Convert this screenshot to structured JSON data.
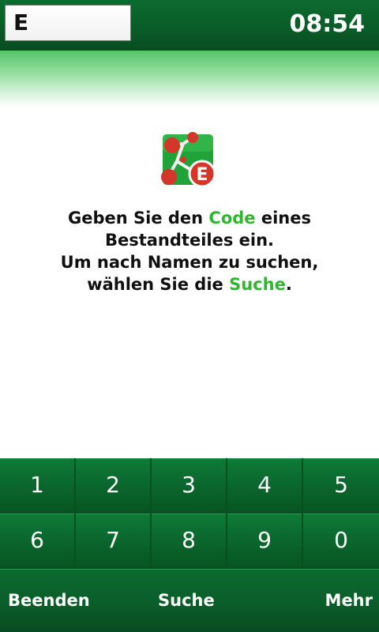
{
  "header": {
    "code_input_value": "E",
    "clock": "08:54"
  },
  "app_logo": {
    "badge_letter": "E",
    "colors": {
      "background": "#22a33a",
      "nodes": "#d4372a",
      "badge": "#d4372a"
    }
  },
  "message": {
    "line1_prefix": "Geben Sie den ",
    "line1_highlight": "Code",
    "line1_suffix": " eines",
    "line2": "Bestandteiles ein.",
    "line3": "Um nach Namen zu suchen,",
    "line4_prefix": "wählen Sie die ",
    "line4_highlight": "Suche",
    "line4_suffix": "."
  },
  "keypad": {
    "row1": [
      "1",
      "2",
      "3",
      "4",
      "5"
    ],
    "row2": [
      "6",
      "7",
      "8",
      "9",
      "0"
    ]
  },
  "menu": {
    "left": "Beenden",
    "center": "Suche",
    "right": "Mehr"
  },
  "colors": {
    "accent_green": "#2fb52f",
    "bar_green": "#0b6a2f"
  }
}
